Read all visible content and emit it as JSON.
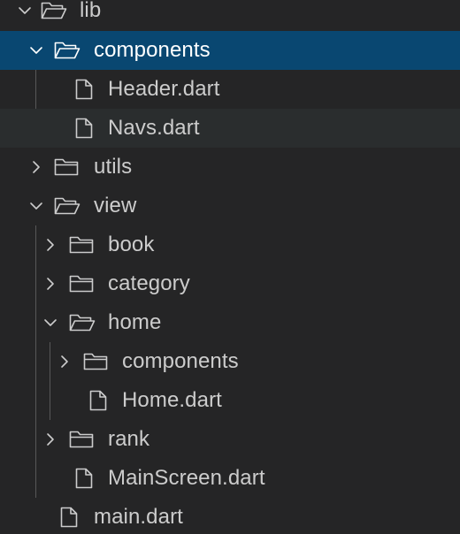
{
  "tree": {
    "lib": {
      "label": "lib",
      "icon": "folder-open-icon",
      "expanded": true
    },
    "lib_components": {
      "label": "components",
      "icon": "folder-open-icon",
      "expanded": true,
      "selected": true
    },
    "header_dart": {
      "label": "Header.dart",
      "icon": "file-icon"
    },
    "navs_dart": {
      "label": "Navs.dart",
      "icon": "file-icon"
    },
    "utils": {
      "label": "utils",
      "icon": "folder-icon",
      "expanded": false
    },
    "view": {
      "label": "view",
      "icon": "folder-open-icon",
      "expanded": true
    },
    "book": {
      "label": "book",
      "icon": "folder-icon",
      "expanded": false
    },
    "category": {
      "label": "category",
      "icon": "folder-icon",
      "expanded": false
    },
    "home": {
      "label": "home",
      "icon": "folder-open-icon",
      "expanded": true
    },
    "home_components": {
      "label": "components",
      "icon": "folder-icon",
      "expanded": false
    },
    "home_dart": {
      "label": "Home.dart",
      "icon": "file-icon"
    },
    "rank": {
      "label": "rank",
      "icon": "folder-icon",
      "expanded": false
    },
    "mainscreen_dart": {
      "label": "MainScreen.dart",
      "icon": "file-icon"
    },
    "main_dart": {
      "label": "main.dart",
      "icon": "file-icon"
    }
  },
  "colors": {
    "background": "#252526",
    "selected_row": "#094771",
    "hover_row": "#2a2d2e",
    "text": "#cccccc",
    "selected_text": "#ffffff",
    "indent_guide": "#585858"
  }
}
